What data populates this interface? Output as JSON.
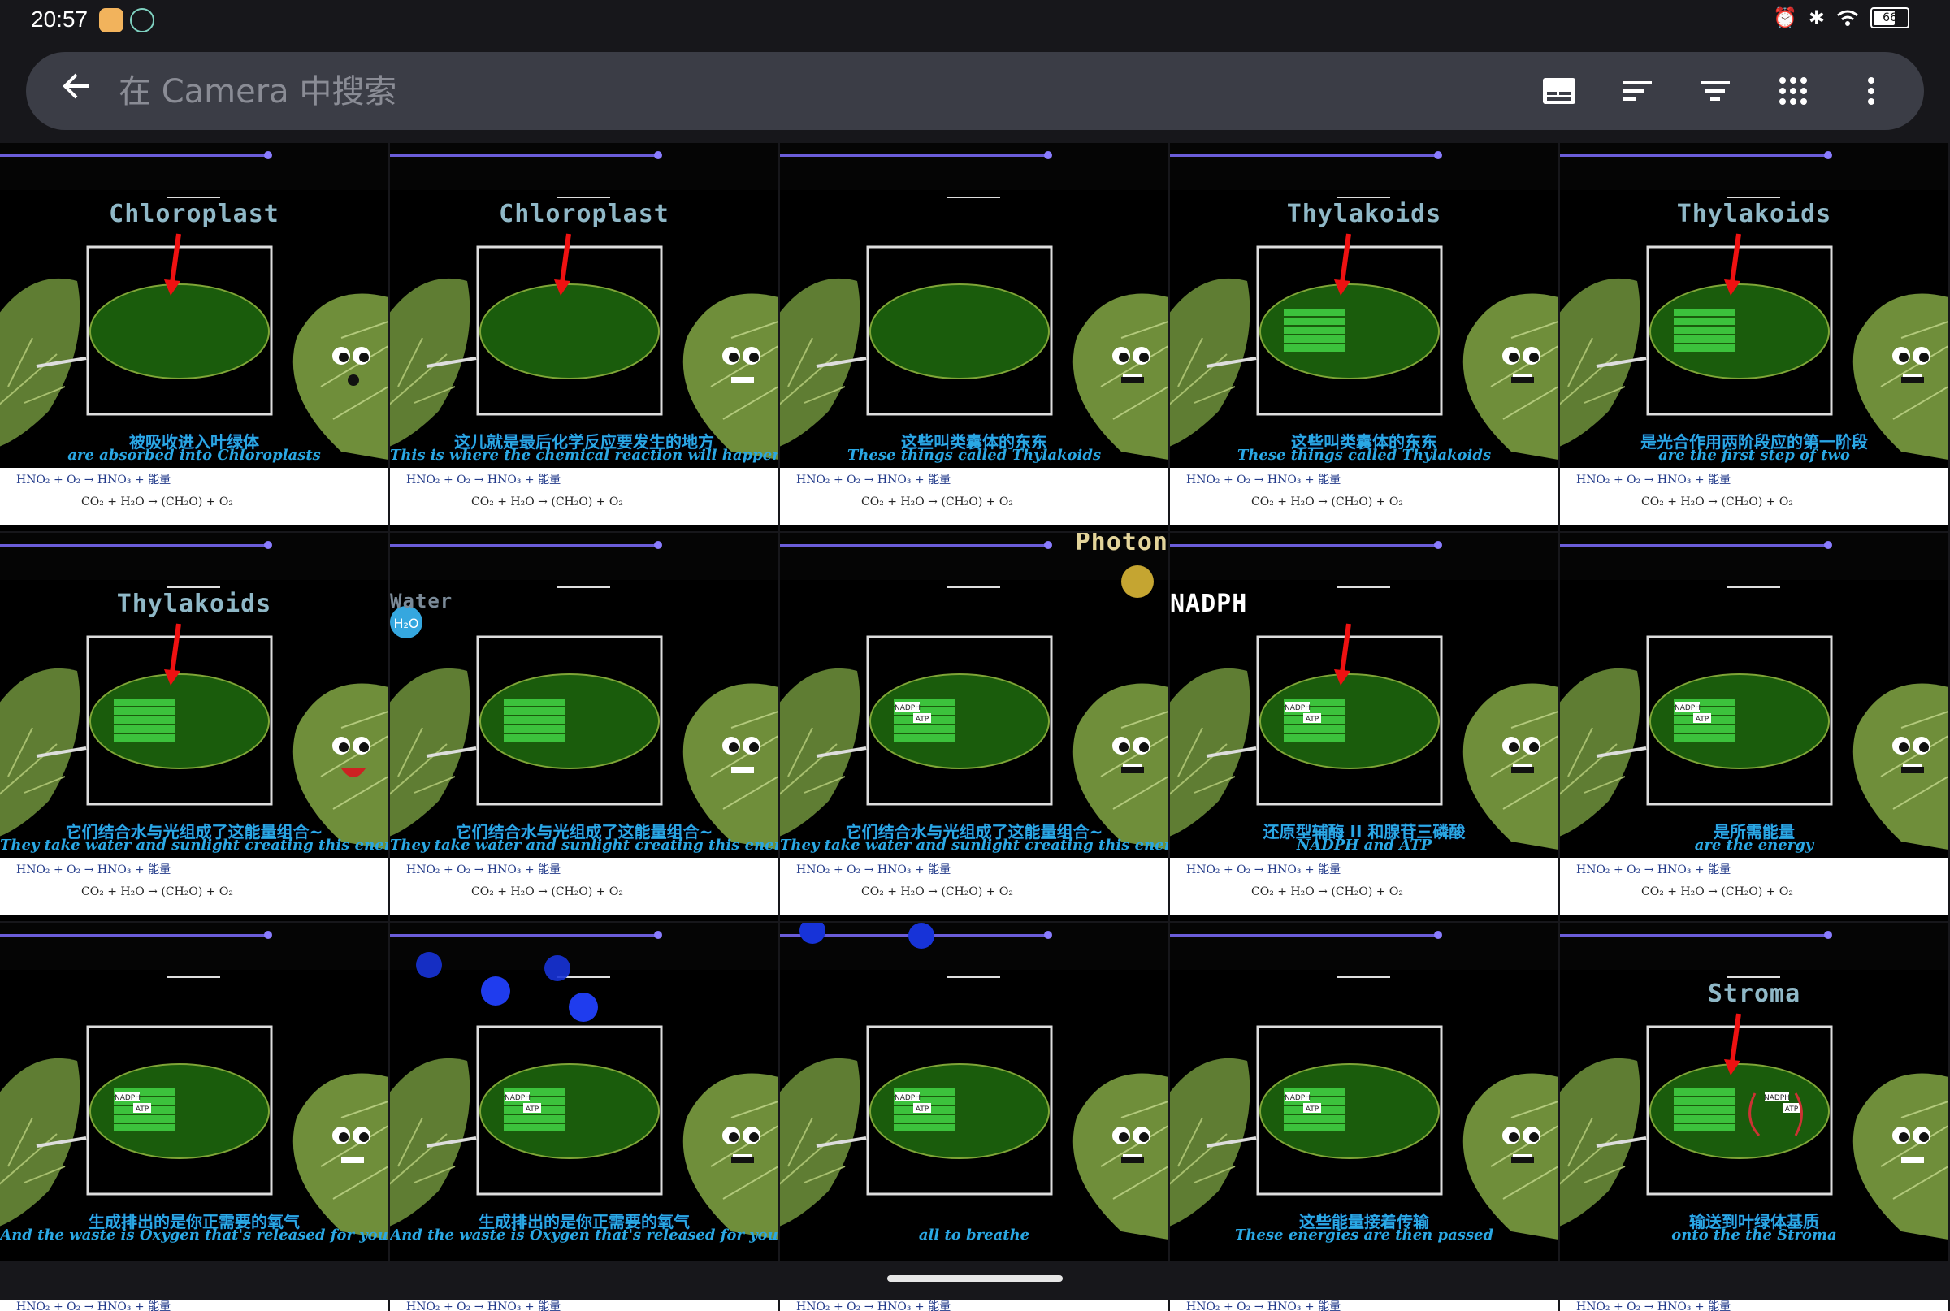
{
  "status": {
    "time": "20:57",
    "battery": "66",
    "icons": [
      "alarm-icon",
      "bluetooth-icon",
      "wifi-icon",
      "battery-icon"
    ]
  },
  "search": {
    "placeholder": "在 Camera 中搜索",
    "value": ""
  },
  "toolbar": {
    "icons": [
      "subtitles-icon",
      "sort-icon",
      "filter-icon",
      "grid-view-icon",
      "more-options-icon"
    ]
  },
  "tiles": [
    {
      "heading": "Chloroplast",
      "zh": "被吸收进入叶绿体",
      "en": "are absorbed into Chloroplasts",
      "stage": "empty",
      "arrow": true,
      "face": "o"
    },
    {
      "heading": "Chloroplast",
      "zh": "这儿就是最后化学反应要发生的地方",
      "en": "This is where the chemical reaction will happen at last",
      "stage": "empty",
      "arrow": true,
      "face": "flat"
    },
    {
      "heading": "",
      "zh": "这些叫类囊体的东东",
      "en": "These things called Thylakoids",
      "stage": "empty",
      "arrow": false,
      "face": "line"
    },
    {
      "heading": "Thylakoids",
      "zh": "这些叫类囊体的东东",
      "en": "These things called Thylakoids",
      "stage": "stack",
      "arrow": true,
      "face": "line"
    },
    {
      "heading": "Thylakoids",
      "zh": "是光合作用两阶段应的第一阶段",
      "en": "are the first step of two",
      "stage": "stack",
      "arrow": true,
      "face": "line"
    },
    {
      "heading": "Thylakoids",
      "zh": "它们结合水与光组成了这能量组合~",
      "en": "They take water and sunlight creating this energy combo",
      "stage": "stack",
      "arrow": true,
      "face": "smile"
    },
    {
      "heading": "Water",
      "zh": "它们结合水与光组成了这能量组合~",
      "en": "They take water and sunlight creating this energy combo",
      "stage": "stack",
      "arrow": false,
      "face": "flat"
    },
    {
      "heading": "Photon",
      "zh": "它们结合水与光组成了这能量组合~",
      "en": "They take water and sunlight creating this energy combo",
      "stage": "nadph",
      "arrow": false,
      "face": "line"
    },
    {
      "heading": "NADPH",
      "zh": "还原型辅酶 II 和腺苷三磷酸",
      "en": "NADPH and ATP",
      "stage": "nadph",
      "arrow": true,
      "face": "line"
    },
    {
      "heading": "",
      "zh": "是所需能量",
      "en": "are the energy",
      "stage": "nadph",
      "arrow": false,
      "face": "line"
    },
    {
      "heading": "",
      "zh": "生成排出的是你正需要的氧气",
      "en": "And the waste is Oxygen that's released for you",
      "stage": "nadph",
      "arrow": false,
      "face": "flat"
    },
    {
      "heading": "",
      "zh": "生成排出的是你正需要的氧气",
      "en": "And the waste is Oxygen that's released for you",
      "stage": "nadph",
      "arrow": false,
      "face": "line"
    },
    {
      "heading": "",
      "zh": "",
      "en": "all to breathe",
      "stage": "nadph",
      "arrow": false,
      "face": "line"
    },
    {
      "heading": "",
      "zh": "这些能量接着传输",
      "en": "These energies are then passed",
      "stage": "nadph",
      "arrow": false,
      "face": "line"
    },
    {
      "heading": "Stroma",
      "zh": "输送到叶绿体基质",
      "en": "onto the the Stroma",
      "stage": "stroma",
      "arrow": true,
      "face": "flat"
    }
  ],
  "formula": {
    "line1": "HNO₂ + O₂ → HNO₃ + 能量",
    "line2": "CO₂ + H₂O → (CH₂O) + O₂"
  },
  "labels": {
    "nadph": "NADPH",
    "atp": "ATP",
    "water_molecule": "H₂O"
  }
}
